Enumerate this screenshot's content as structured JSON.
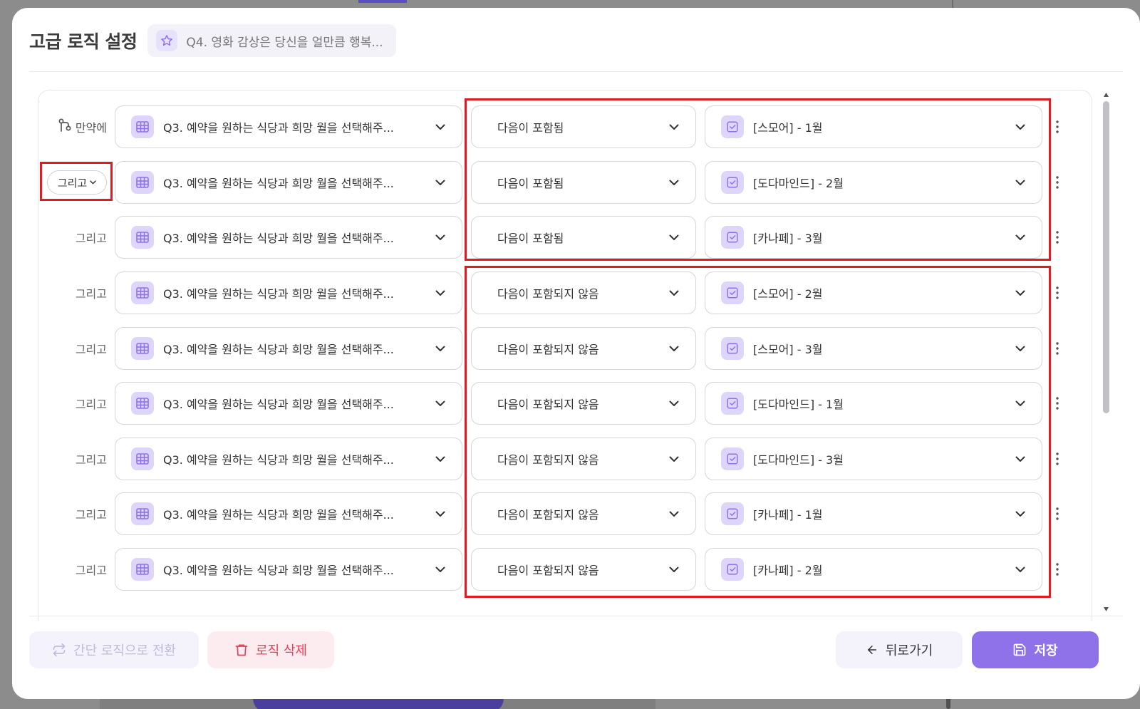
{
  "header": {
    "title": "고급 로직 설정",
    "question_chip": "Q4. 영화 감상은 당신을 얼만큼 행복..."
  },
  "labels": {
    "if": "만약에",
    "and": "그리고"
  },
  "rows": [
    {
      "connector": "만약에",
      "question": "Q3. 예약을 원하는 식당과 희망 월을 선택해주...",
      "operator": "다음이 포함됨",
      "value": "[스모어] - 1월"
    },
    {
      "connector": "그리고",
      "question": "Q3. 예약을 원하는 식당과 희망 월을 선택해주...",
      "operator": "다음이 포함됨",
      "value": "[도다마인드] - 2월"
    },
    {
      "connector": "그리고",
      "question": "Q3. 예약을 원하는 식당과 희망 월을 선택해주...",
      "operator": "다음이 포함됨",
      "value": "[카나페] - 3월"
    },
    {
      "connector": "그리고",
      "question": "Q3. 예약을 원하는 식당과 희망 월을 선택해주...",
      "operator": "다음이 포함되지 않음",
      "value": "[스모어] - 2월"
    },
    {
      "connector": "그리고",
      "question": "Q3. 예약을 원하는 식당과 희망 월을 선택해주...",
      "operator": "다음이 포함되지 않음",
      "value": "[스모어] - 3월"
    },
    {
      "connector": "그리고",
      "question": "Q3. 예약을 원하는 식당과 희망 월을 선택해주...",
      "operator": "다음이 포함되지 않음",
      "value": "[도다마인드] - 1월"
    },
    {
      "connector": "그리고",
      "question": "Q3. 예약을 원하는 식당과 희망 월을 선택해주...",
      "operator": "다음이 포함되지 않음",
      "value": "[도다마인드] - 3월"
    },
    {
      "connector": "그리고",
      "question": "Q3. 예약을 원하는 식당과 희망 월을 선택해주...",
      "operator": "다음이 포함되지 않음",
      "value": "[카나페] - 1월"
    },
    {
      "connector": "그리고",
      "question": "Q3. 예약을 원하는 식당과 희망 월을 선택해주...",
      "operator": "다음이 포함되지 않음",
      "value": "[카나페] - 2월"
    }
  ],
  "footer": {
    "convert_label": "간단 로직으로 전환",
    "delete_label": "로직 삭제",
    "back_label": "뒤로가기",
    "save_label": "저장"
  },
  "colors": {
    "accent": "#8f72ea",
    "icon_bg": "#ddd6fa",
    "highlight": "#e11b22",
    "delete": "#e4405b"
  }
}
